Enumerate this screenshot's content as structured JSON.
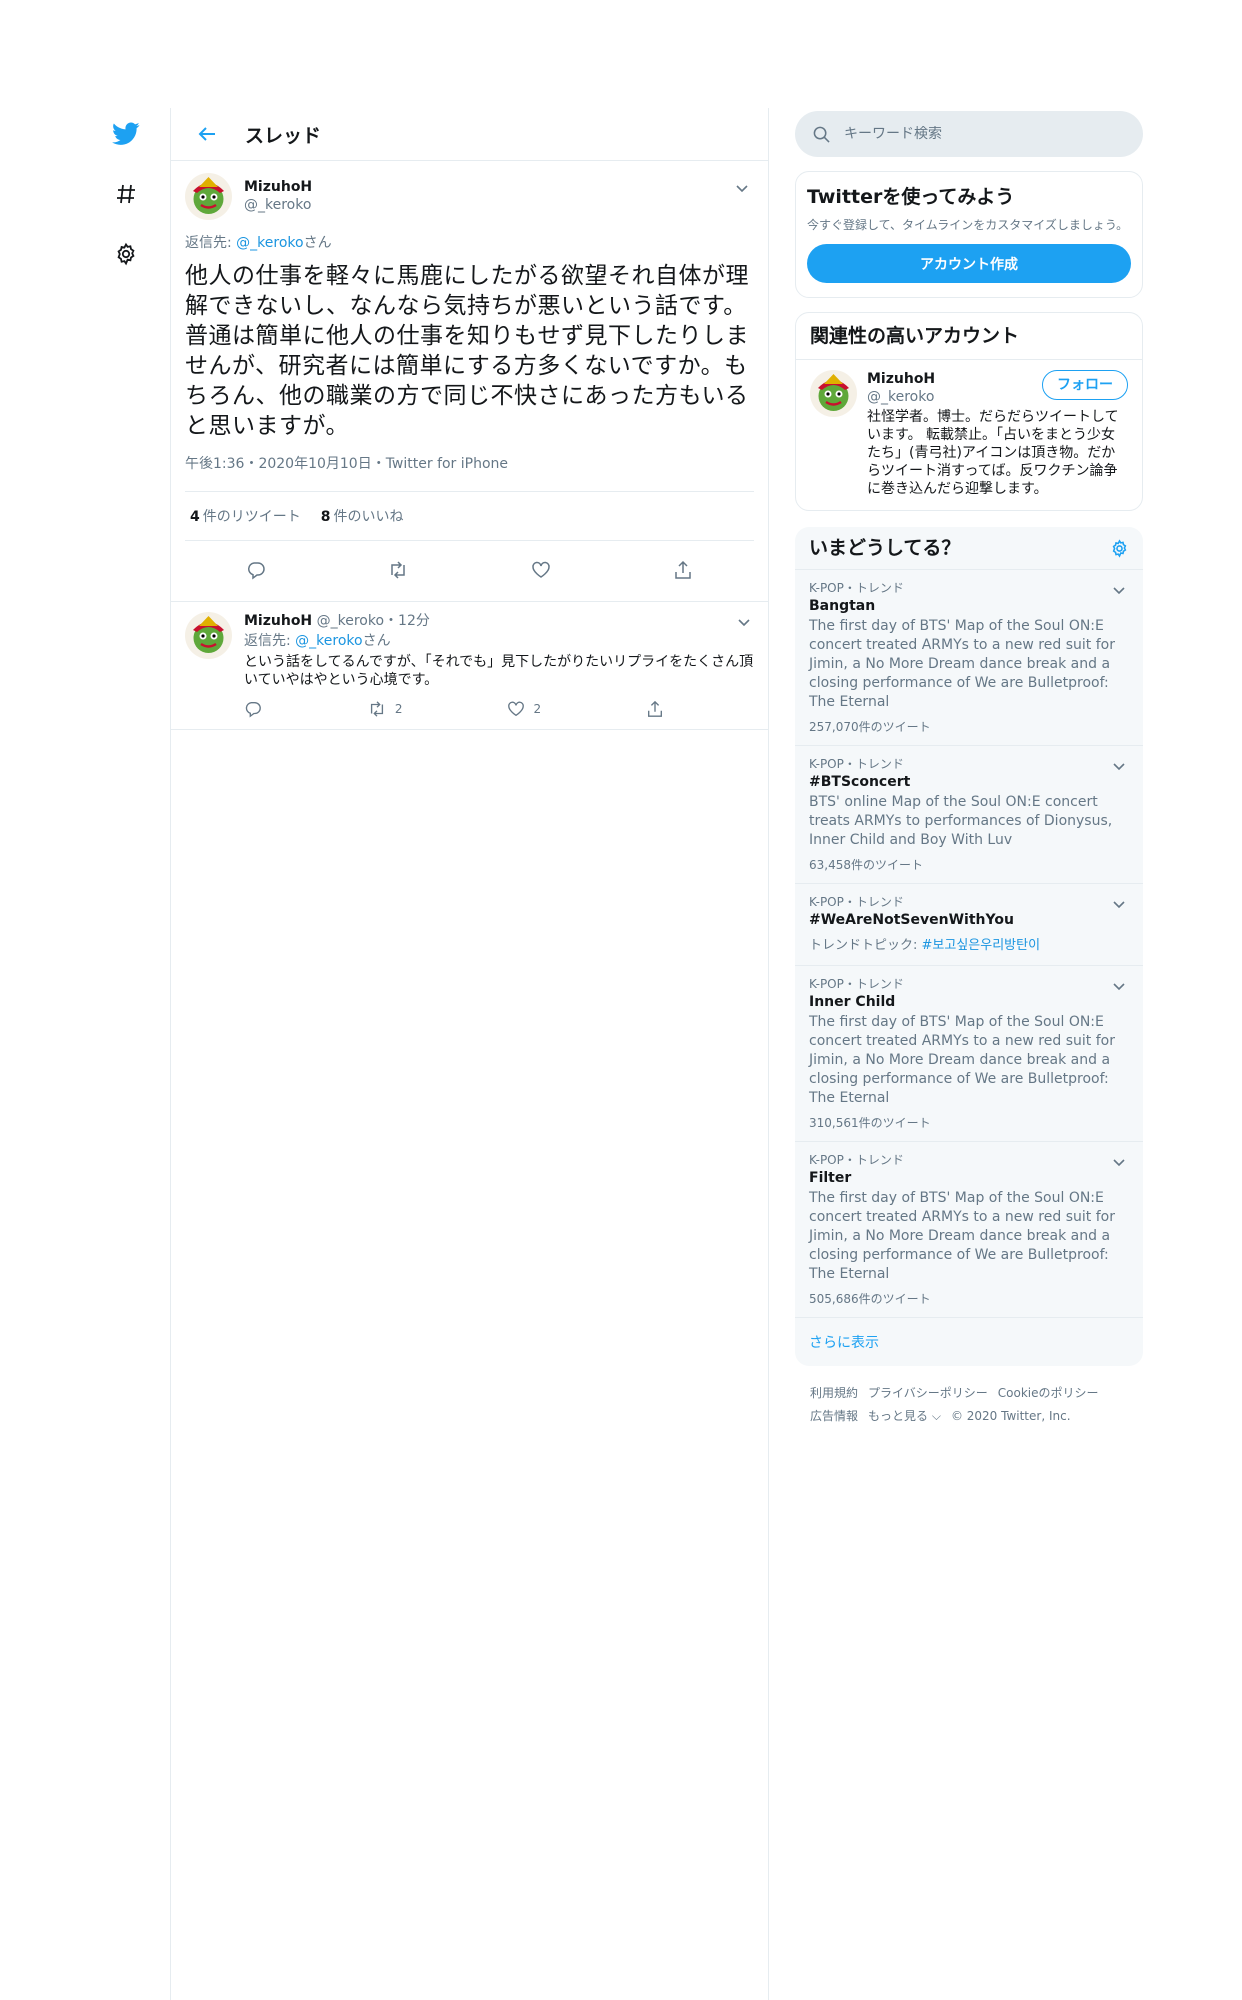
{
  "header": {
    "title": "スレッド"
  },
  "nav": {
    "icons": [
      "twitter-bird-icon",
      "hashtag-icon",
      "settings-icon"
    ]
  },
  "tweet": {
    "name": "MizuhoH",
    "handle": "@_keroko",
    "reply_to_label": "返信先: ",
    "reply_to_handle": "@_keroko",
    "reply_to_suffix": "さん",
    "text": "他人の仕事を軽々に馬鹿にしたがる欲望それ自体が理解できないし、なんなら気持ちが悪いという話です。普通は簡単に他人の仕事を知りもせず見下したりしませんが、研究者には簡単にする方多くないですか。もちろん、他の職業の方で同じ不快さにあった方もいると思いますが。",
    "meta": "午後1:36・2020年10月10日・Twitter for iPhone",
    "retweets_count": "4",
    "retweets_label": "件のリツイート",
    "likes_count": "8",
    "likes_label": "件のいいね"
  },
  "reply": {
    "name": "MizuhoH",
    "handle": "@_keroko",
    "age": "・12分",
    "reply_to_label": "返信先: ",
    "reply_to_handle": "@_keroko",
    "reply_to_suffix": "さん",
    "text": "という話をしてるんですが、「それでも」見下したがりたいリプライをたくさん頂いていやはやという心境です。",
    "retweets": "2",
    "likes": "2"
  },
  "search": {
    "placeholder": "キーワード検索"
  },
  "signup": {
    "title": "Twitterを使ってみよう",
    "subtitle": "今すぐ登録して、タイムラインをカスタマイズしましょう。",
    "button": "アカウント作成"
  },
  "related": {
    "title": "関連性の高いアカウント",
    "name": "MizuhoH",
    "handle": "@_keroko",
    "follow": "フォロー",
    "bio": "社怪学者。博士。だらだらツイートしています。 転載禁止。「占いをまとう少女たち」(青弓社)アイコンは頂き物。だからツイート消すってば。反ワクチン論争に巻き込んだら迎撃します。"
  },
  "trends": {
    "title": "いまどうしてる？",
    "items": [
      {
        "context": "K-POP・トレンド",
        "name": "Bangtan",
        "desc": "The first day of BTS' Map of the Soul ON:E concert treated ARMYs to a new red suit for Jimin, a No More Dream dance break and a closing performance of We are Bulletproof: The Eternal",
        "count": "257,070件のツイート"
      },
      {
        "context": "K-POP・トレンド",
        "name": "#BTSconcert",
        "desc": "BTS' online Map of the Soul ON:E concert treats ARMYs to performances of Dionysus, Inner Child and Boy With Luv",
        "count": "63,458件のツイート"
      },
      {
        "context": "K-POP・トレンド",
        "name": "#WeAreNotSevenWithYou",
        "topic_label": "トレンドトピック: ",
        "topic": "#보고싶은우리방탄이"
      },
      {
        "context": "K-POP・トレンド",
        "name": "Inner Child",
        "desc": "The first day of BTS' Map of the Soul ON:E concert treated ARMYs to a new red suit for Jimin, a No More Dream dance break and a closing performance of We are Bulletproof: The Eternal",
        "count": "310,561件のツイート"
      },
      {
        "context": "K-POP・トレンド",
        "name": "Filter",
        "desc": "The first day of BTS' Map of the Soul ON:E concert treated ARMYs to a new red suit for Jimin, a No More Dream dance break and a closing performance of We are Bulletproof: The Eternal",
        "count": "505,686件のツイート"
      }
    ],
    "more": "さらに表示"
  },
  "footer": {
    "row1": [
      "利用規約",
      "プライバシーポリシー",
      "Cookieのポリシー"
    ],
    "row2": [
      "広告情報",
      "もっと見る ⌵",
      "© 2020 Twitter, Inc."
    ]
  },
  "colors": {
    "accent": "#1da1f2",
    "text": "#14171a",
    "muted": "#657786",
    "border": "#e6ecf0"
  }
}
